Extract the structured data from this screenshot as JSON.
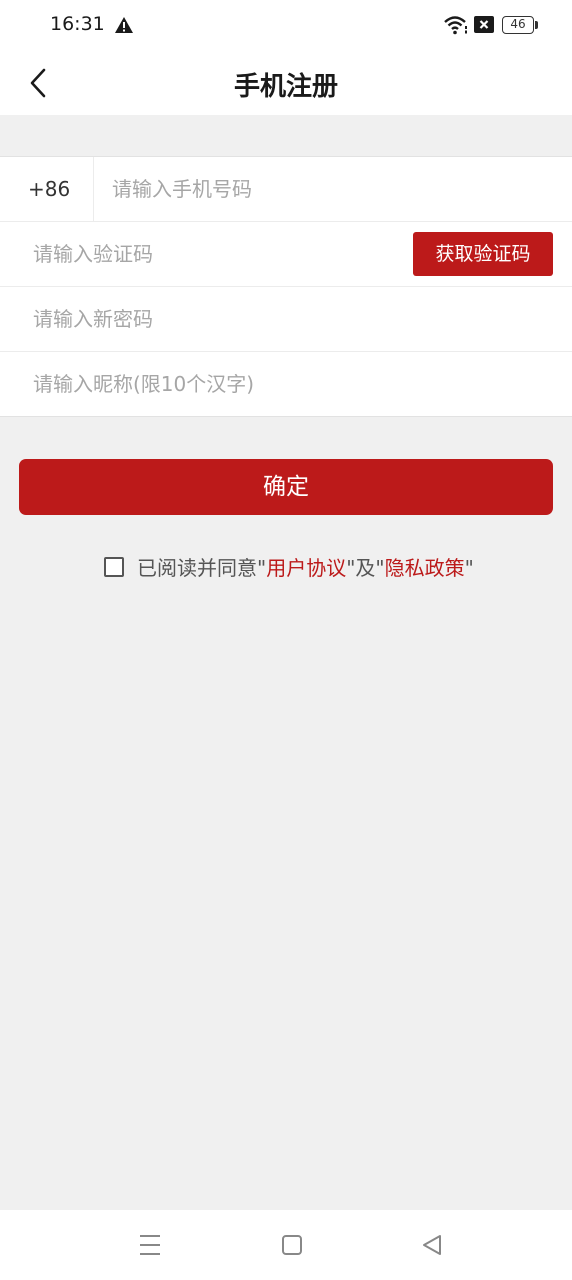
{
  "status": {
    "time": "16:31",
    "battery": "46",
    "icons": [
      "alert-icon",
      "wifi-icon",
      "sim-x-icon",
      "battery-icon"
    ]
  },
  "header": {
    "title": "手机注册",
    "back_icon": "chevron-left-icon"
  },
  "form": {
    "country_code": "+86",
    "phone_placeholder": "请输入手机号码",
    "code_placeholder": "请输入验证码",
    "get_code_label": "获取验证码",
    "password_placeholder": "请输入新密码",
    "nickname_placeholder": "请输入昵称(限10个汉字)"
  },
  "confirm_label": "确定",
  "agreement": {
    "prefix": "已阅读并同意",
    "quote": "\"",
    "user_agreement": "用户协议",
    "and": "及",
    "privacy_policy": "隐私政策"
  },
  "colors": {
    "accent": "#bc1a1a",
    "background": "#f0f0f0"
  },
  "system_nav": {
    "icons": [
      "menu-icon",
      "home-icon",
      "back-icon"
    ]
  }
}
